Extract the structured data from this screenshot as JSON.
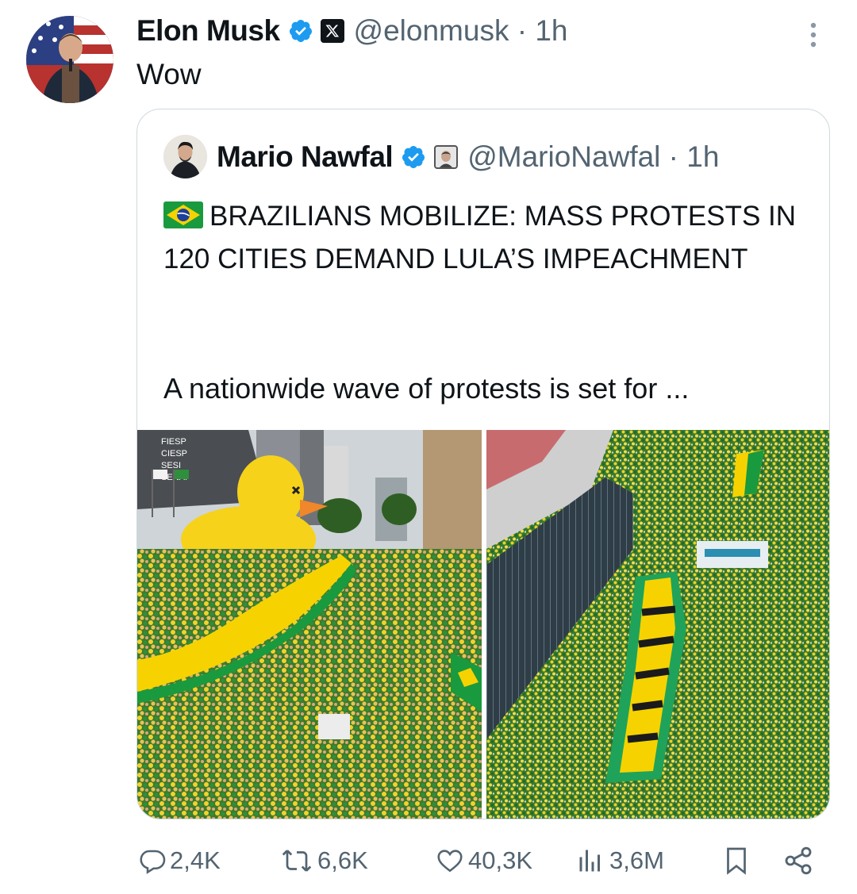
{
  "tweet": {
    "author_name": "Elon Musk",
    "handle_time": "@elonmusk · 1h",
    "text": "Wow"
  },
  "quote": {
    "author_name": "Mario Nawfal",
    "handle_time": "@MarioNawfal · 1h",
    "headline": "BRAZILIANS MOBILIZE: MASS PROTESTS IN 120 CITIES DEMAND LULA’S IMPEACHMENT",
    "body": "A nationwide wave of protests is set for ...",
    "image_left_signage": [
      "FIESP",
      "CIESP",
      "SESI",
      "SENAI"
    ]
  },
  "actions": {
    "replies": "2,4K",
    "reposts": "6,6K",
    "likes": "40,3K",
    "views": "3,6M"
  },
  "icons": [
    "verified-icon",
    "x-affiliation-icon",
    "more-icon",
    "reply-icon",
    "repost-icon",
    "like-icon",
    "views-icon",
    "bookmark-icon",
    "share-icon"
  ],
  "colors": {
    "verified": "#1d9bf0",
    "muted": "#536471",
    "brazil_green": "#1a9a3e",
    "brazil_yellow": "#f6d300"
  }
}
